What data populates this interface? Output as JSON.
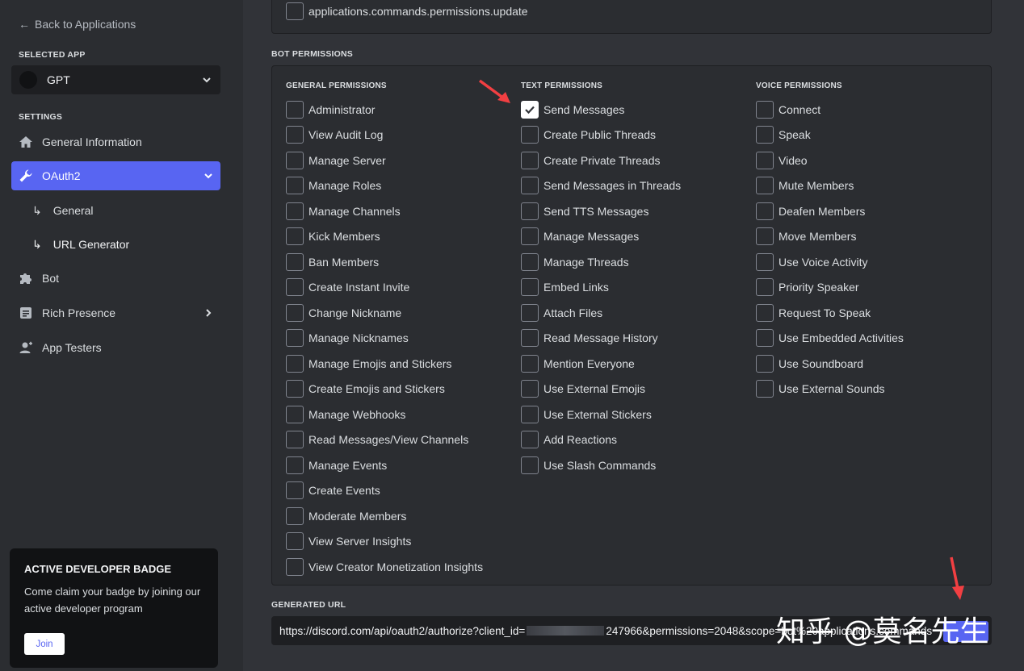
{
  "sidebar": {
    "back_label": "Back to Applications",
    "selected_app_label": "SELECTED APP",
    "app_name": "GPT",
    "settings_label": "SETTINGS",
    "nav": {
      "general_information": "General Information",
      "oauth2": "OAuth2",
      "oauth2_general": "General",
      "url_generator": "URL Generator",
      "bot": "Bot",
      "rich_presence": "Rich Presence",
      "app_testers": "App Testers"
    },
    "badge": {
      "title": "ACTIVE DEVELOPER BADGE",
      "text": "Come claim your badge by joining our active developer program",
      "join_label": "Join"
    }
  },
  "main": {
    "top_scope": "applications.commands.permissions.update",
    "bot_permissions_label": "BOT PERMISSIONS",
    "columns": {
      "general": {
        "header": "GENERAL PERMISSIONS",
        "items": [
          {
            "label": "Administrator",
            "checked": false
          },
          {
            "label": "View Audit Log",
            "checked": false
          },
          {
            "label": "Manage Server",
            "checked": false
          },
          {
            "label": "Manage Roles",
            "checked": false
          },
          {
            "label": "Manage Channels",
            "checked": false
          },
          {
            "label": "Kick Members",
            "checked": false
          },
          {
            "label": "Ban Members",
            "checked": false
          },
          {
            "label": "Create Instant Invite",
            "checked": false
          },
          {
            "label": "Change Nickname",
            "checked": false
          },
          {
            "label": "Manage Nicknames",
            "checked": false
          },
          {
            "label": "Manage Emojis and Stickers",
            "checked": false
          },
          {
            "label": "Create Emojis and Stickers",
            "checked": false
          },
          {
            "label": "Manage Webhooks",
            "checked": false
          },
          {
            "label": "Read Messages/View Channels",
            "checked": false
          },
          {
            "label": "Manage Events",
            "checked": false
          },
          {
            "label": "Create Events",
            "checked": false
          },
          {
            "label": "Moderate Members",
            "checked": false
          },
          {
            "label": "View Server Insights",
            "checked": false
          },
          {
            "label": "View Creator Monetization Insights",
            "checked": false
          }
        ]
      },
      "text": {
        "header": "TEXT PERMISSIONS",
        "items": [
          {
            "label": "Send Messages",
            "checked": true
          },
          {
            "label": "Create Public Threads",
            "checked": false
          },
          {
            "label": "Create Private Threads",
            "checked": false
          },
          {
            "label": "Send Messages in Threads",
            "checked": false
          },
          {
            "label": "Send TTS Messages",
            "checked": false
          },
          {
            "label": "Manage Messages",
            "checked": false
          },
          {
            "label": "Manage Threads",
            "checked": false
          },
          {
            "label": "Embed Links",
            "checked": false
          },
          {
            "label": "Attach Files",
            "checked": false
          },
          {
            "label": "Read Message History",
            "checked": false
          },
          {
            "label": "Mention Everyone",
            "checked": false
          },
          {
            "label": "Use External Emojis",
            "checked": false
          },
          {
            "label": "Use External Stickers",
            "checked": false
          },
          {
            "label": "Add Reactions",
            "checked": false
          },
          {
            "label": "Use Slash Commands",
            "checked": false
          }
        ]
      },
      "voice": {
        "header": "VOICE PERMISSIONS",
        "items": [
          {
            "label": "Connect",
            "checked": false
          },
          {
            "label": "Speak",
            "checked": false
          },
          {
            "label": "Video",
            "checked": false
          },
          {
            "label": "Mute Members",
            "checked": false
          },
          {
            "label": "Deafen Members",
            "checked": false
          },
          {
            "label": "Move Members",
            "checked": false
          },
          {
            "label": "Use Voice Activity",
            "checked": false
          },
          {
            "label": "Priority Speaker",
            "checked": false
          },
          {
            "label": "Request To Speak",
            "checked": false
          },
          {
            "label": "Use Embedded Activities",
            "checked": false
          },
          {
            "label": "Use Soundboard",
            "checked": false
          },
          {
            "label": "Use External Sounds",
            "checked": false
          }
        ]
      }
    },
    "generated_url_label": "GENERATED URL",
    "url_prefix": "https://discord.com/api/oauth2/authorize?client_id=",
    "url_suffix": "247966&permissions=2048&scope=bot%20applications.commands",
    "watermark": "知乎 @莫名先生"
  },
  "colors": {
    "accent": "#5865f2",
    "arrow": "#f23f42",
    "sidebar_bg": "#2b2d31",
    "main_bg": "#313338"
  }
}
